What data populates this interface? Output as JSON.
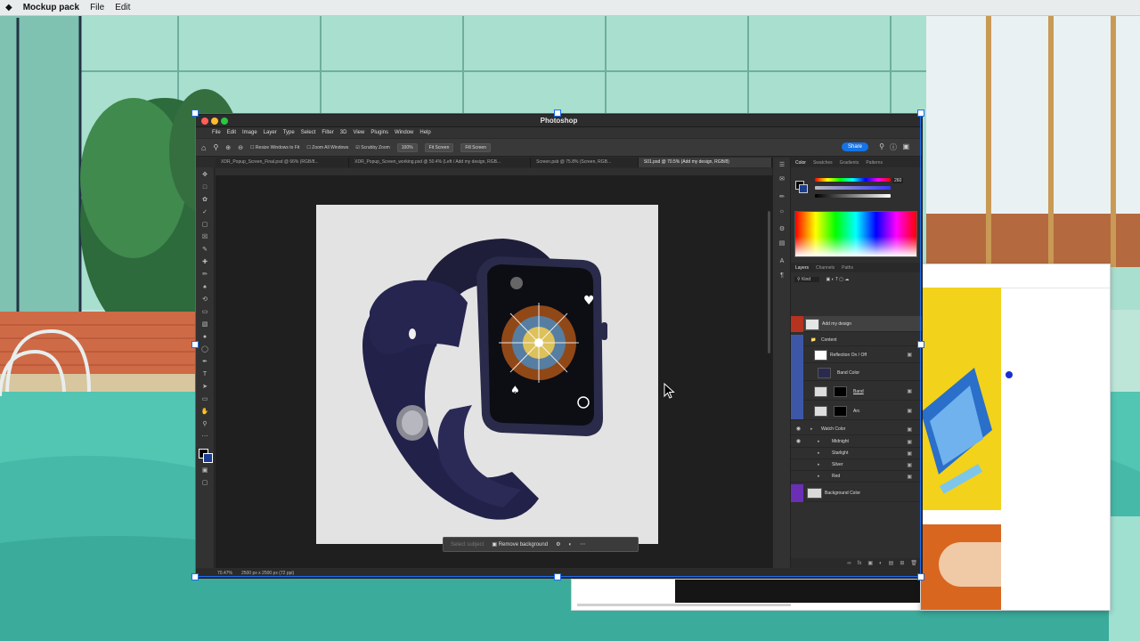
{
  "menubar": {
    "app_name": "Mockup pack",
    "items": [
      "File",
      "Edit"
    ]
  },
  "photoshop": {
    "window_title": "Photoshop",
    "menu": [
      "File",
      "Edit",
      "Image",
      "Layer",
      "Type",
      "Select",
      "Filter",
      "3D",
      "View",
      "Plugins",
      "Window",
      "Help"
    ],
    "options": {
      "resize_windows": "Resize Windows to Fit",
      "zoom_all": "Zoom All Windows",
      "scrubby_zoom": "Scrubby Zoom",
      "zoom_value": "100%",
      "fit_screen": "Fit Screen",
      "fill_screen": "Fill Screen",
      "share": "Share"
    },
    "tabs": [
      "XDR_Popup_Screen_Final.psd @ 66% (RGB/8...",
      "XDR_Popup_Screen_working.psd @ 50.4% (Left / Add my design, RGB...",
      "Screen.psb @ 75.8% (Screen, RGB...",
      "S01.psd @ 70.5% (Add my design, RGB/8)"
    ],
    "context_bar": {
      "select_subject": "Select subject",
      "remove_background": "Remove background"
    },
    "status": {
      "zoom": "70.47%",
      "doc_size": "2500 px x 2500 px (72 ppi)"
    },
    "panels": {
      "color_tabs": [
        "Color",
        "Swatches",
        "Gradients",
        "Patterns"
      ],
      "color_value": "260",
      "layer_tabs": [
        "Layers",
        "Channels",
        "Paths"
      ],
      "layer_filter": "Kind",
      "layers": [
        {
          "name": "Add my design",
          "kind": "smart"
        },
        {
          "name": "Content",
          "kind": "group"
        },
        {
          "name": "Reflection On / Off",
          "kind": "layer"
        },
        {
          "name": "Band Color",
          "kind": "layer"
        },
        {
          "name": "Band",
          "kind": "layer"
        },
        {
          "name": "Arc",
          "kind": "layer"
        },
        {
          "name": "Watch Color",
          "kind": "group"
        },
        {
          "name": "Midnight",
          "kind": "group"
        },
        {
          "name": "Starlight",
          "kind": "group"
        },
        {
          "name": "Silver",
          "kind": "group"
        },
        {
          "name": "Red",
          "kind": "group"
        },
        {
          "name": "Background Color",
          "kind": "layer"
        }
      ]
    }
  },
  "colors": {
    "ps_bg": "#2b2b2b",
    "accent_blue": "#1473e6",
    "selection_blue": "#1a6cf0",
    "watch_band": "#1e1d3a"
  }
}
